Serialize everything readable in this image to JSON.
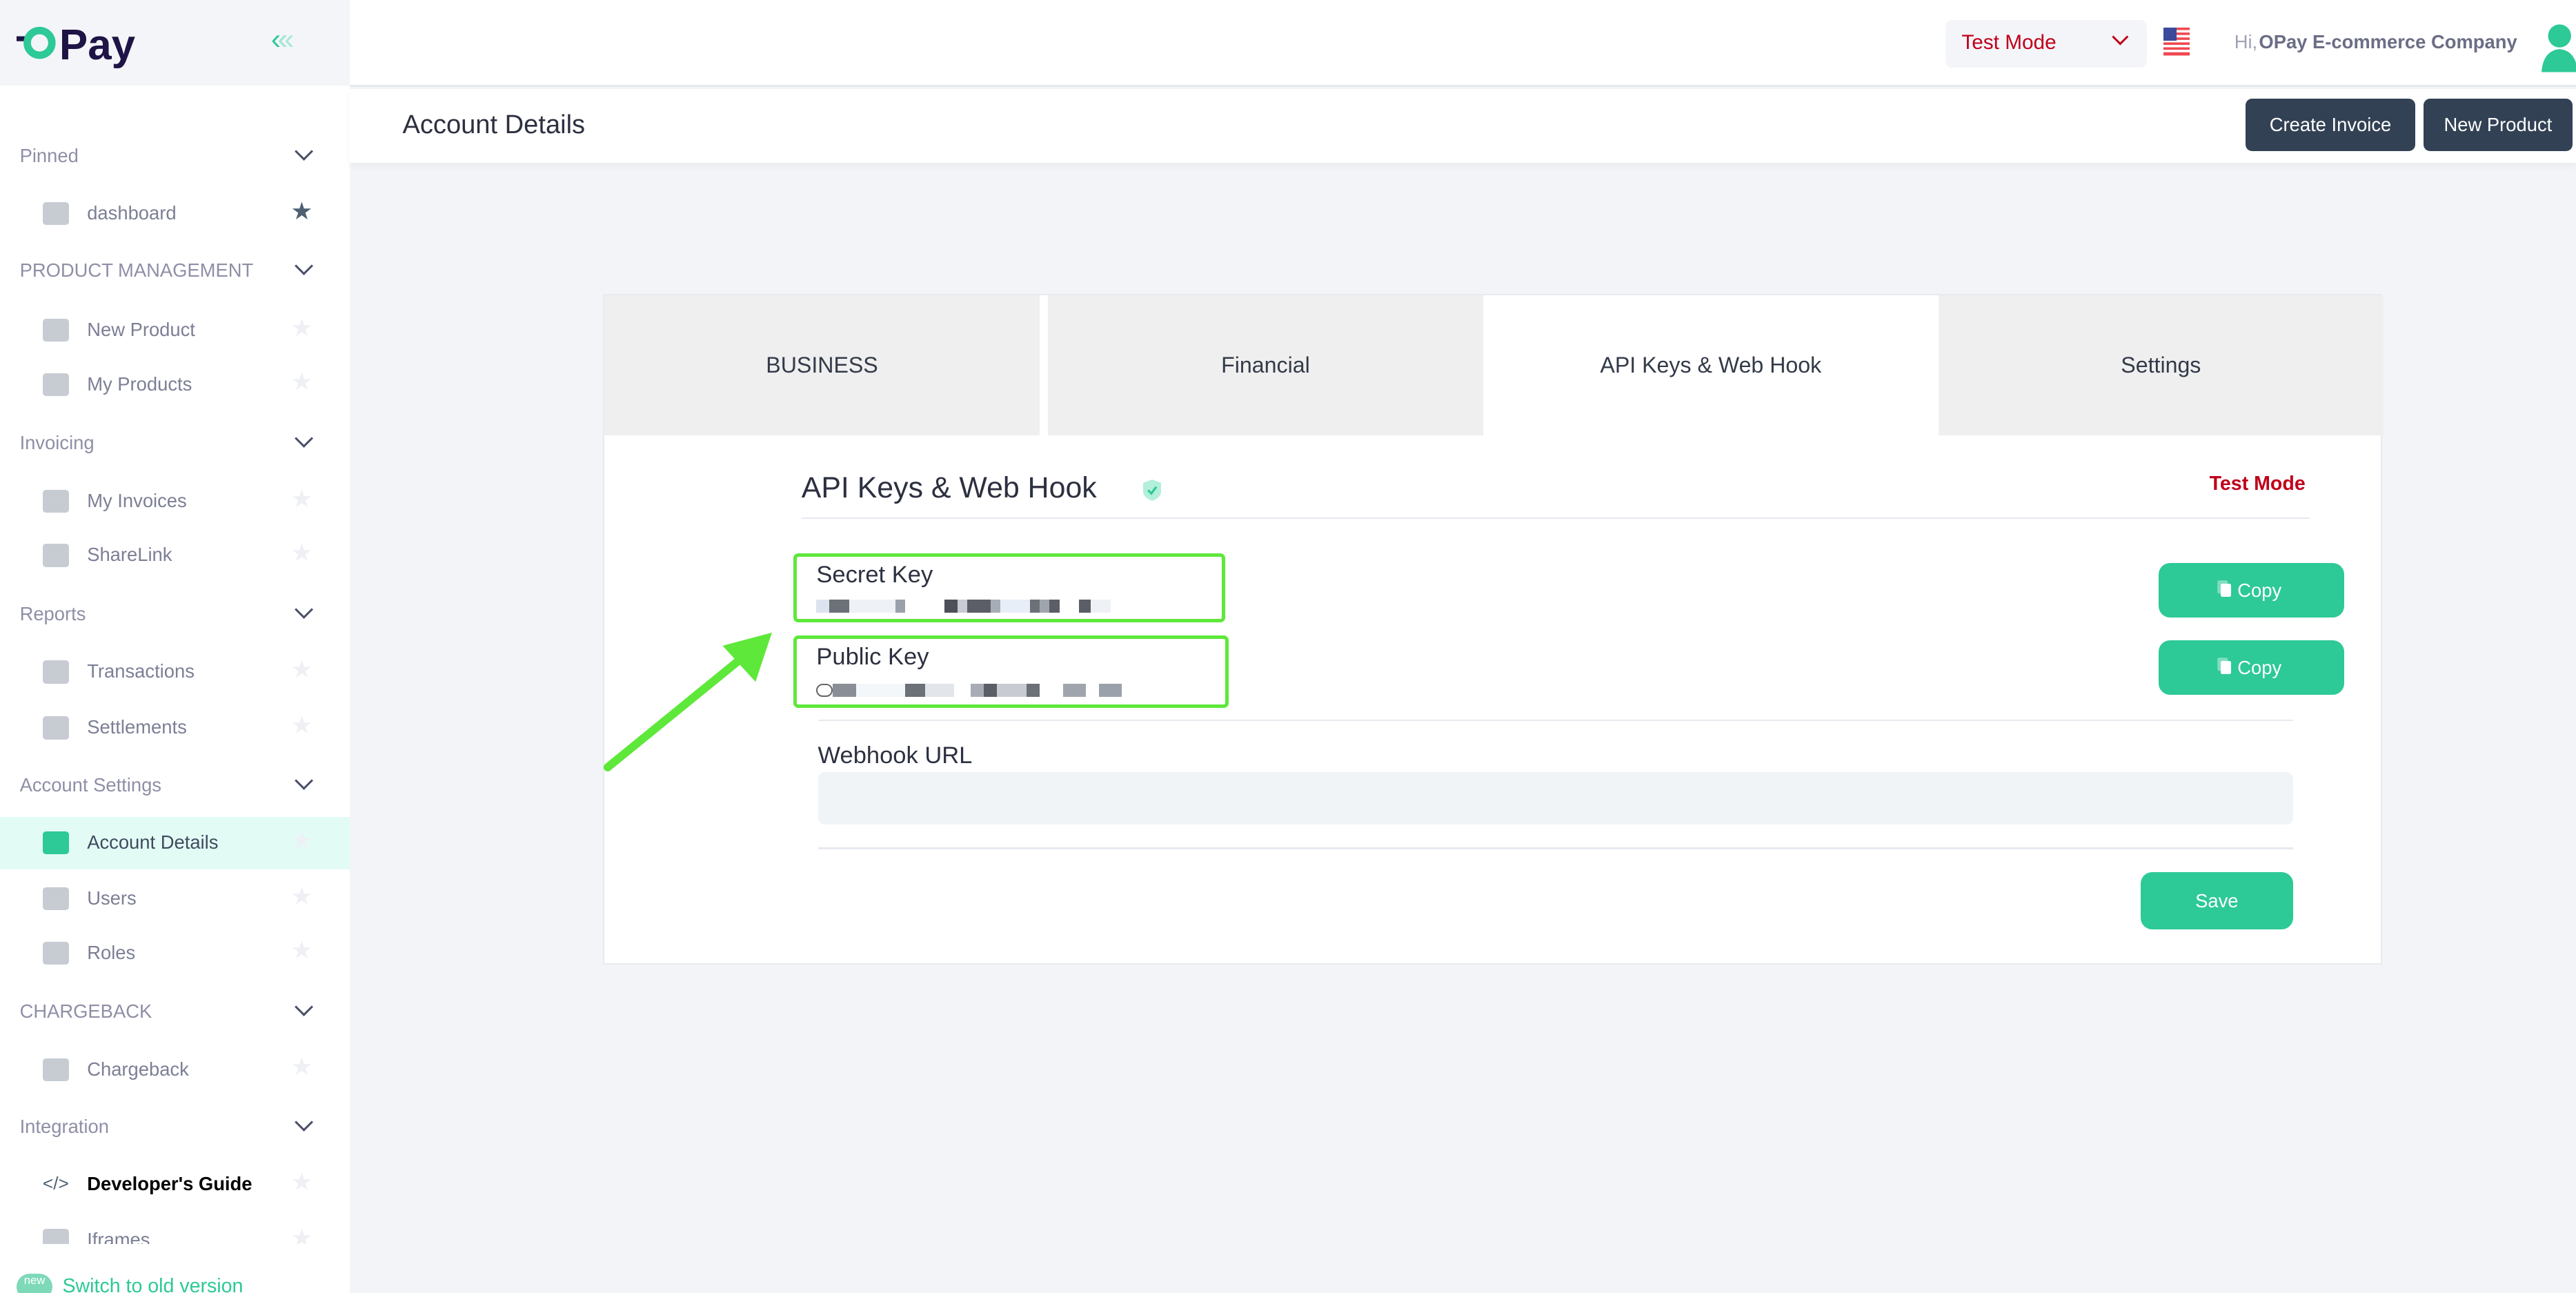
{
  "brand": {
    "logo_text": "OPay",
    "accent": "#2dc997",
    "dark": "#1e1446"
  },
  "sidebar": {
    "sections": [
      {
        "title": "Pinned",
        "items": [
          {
            "label": "dashboard",
            "icon": "pulse-icon",
            "pinned": true
          }
        ]
      },
      {
        "title": "PRODUCT MANAGEMENT",
        "items": [
          {
            "label": "New Product",
            "icon": "scan-icon"
          },
          {
            "label": "My Products",
            "icon": "box-icon"
          }
        ]
      },
      {
        "title": "Invoicing",
        "items": [
          {
            "label": "My Invoices",
            "icon": "invoice-icon"
          },
          {
            "label": "ShareLink",
            "icon": "link-icon"
          }
        ]
      },
      {
        "title": "Reports",
        "items": [
          {
            "label": "Transactions",
            "icon": "lightning-list-icon"
          },
          {
            "label": "Settlements",
            "icon": "cash-icon"
          }
        ]
      },
      {
        "title": "Account Settings",
        "items": [
          {
            "label": "Account Details",
            "icon": "list-icon",
            "active": true
          },
          {
            "label": "Users",
            "icon": "users-icon"
          },
          {
            "label": "Roles",
            "icon": "shield-user-icon"
          }
        ]
      },
      {
        "title": "CHARGEBACK",
        "items": [
          {
            "label": "Chargeback",
            "icon": "drawer-icon"
          }
        ]
      },
      {
        "title": "Integration",
        "items": [
          {
            "label": "Developer's Guide",
            "icon": "code-icon",
            "bold": true
          },
          {
            "label": "Iframes",
            "icon": "bolt-icon"
          }
        ]
      }
    ],
    "footer": {
      "badge": "new",
      "link": "Switch to old version"
    }
  },
  "header": {
    "mode_select": "Test Mode",
    "greeting": "Hi,",
    "company": "OPay E-commerce Company",
    "mode_color": "#c0001a"
  },
  "page": {
    "title": "Account Details",
    "buttons": {
      "create_invoice": "Create Invoice",
      "new_product": "New Product"
    }
  },
  "tabs": [
    {
      "label": "BUSINESS"
    },
    {
      "label": "Financial"
    },
    {
      "label": "API Keys & Web Hook",
      "active": true
    },
    {
      "label": "Settings"
    }
  ],
  "api": {
    "title": "API Keys & Web Hook",
    "mode": "Test Mode",
    "secret_key": {
      "label": "Secret Key",
      "value_redacted": true
    },
    "public_key": {
      "label": "Public Key",
      "value_redacted": true
    },
    "copy_label": "Copy",
    "webhook": {
      "label": "Webhook URL",
      "value": ""
    },
    "save_label": "Save"
  }
}
